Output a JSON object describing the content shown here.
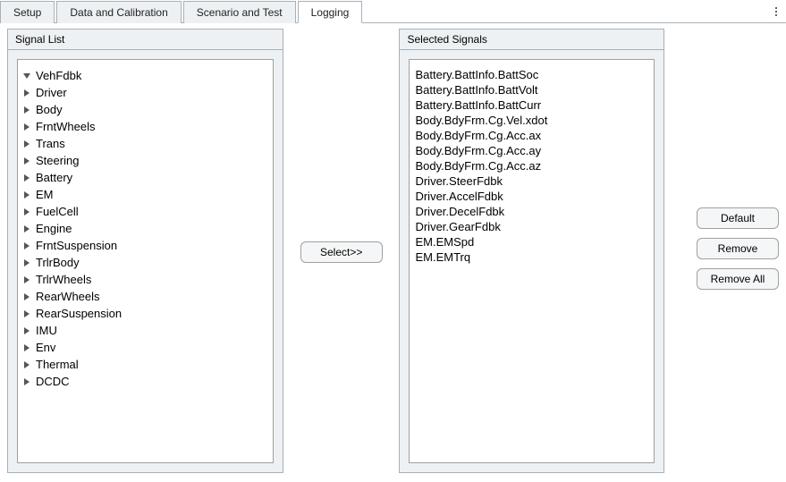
{
  "tabs": {
    "items": [
      {
        "label": "Setup",
        "active": false
      },
      {
        "label": "Data and Calibration",
        "active": false
      },
      {
        "label": "Scenario and Test",
        "active": false
      },
      {
        "label": "Logging",
        "active": true
      }
    ]
  },
  "signal_list": {
    "title": "Signal List",
    "root": {
      "label": "VehFdbk",
      "expanded": true,
      "children": [
        {
          "label": "Driver"
        },
        {
          "label": "Body"
        },
        {
          "label": "FrntWheels"
        },
        {
          "label": "Trans"
        },
        {
          "label": "Steering"
        },
        {
          "label": "Battery"
        },
        {
          "label": "EM"
        },
        {
          "label": "FuelCell"
        },
        {
          "label": "Engine"
        },
        {
          "label": "FrntSuspension"
        },
        {
          "label": "TrlrBody"
        },
        {
          "label": "TrlrWheels"
        },
        {
          "label": "RearWheels"
        },
        {
          "label": "RearSuspension"
        },
        {
          "label": "IMU"
        },
        {
          "label": "Env"
        },
        {
          "label": "Thermal"
        },
        {
          "label": "DCDC"
        }
      ]
    }
  },
  "buttons": {
    "select": "Select>>",
    "default": "Default",
    "remove": "Remove",
    "remove_all": "Remove All"
  },
  "selected_signals": {
    "title": "Selected Signals",
    "items": [
      "Battery.BattInfo.BattSoc",
      "Battery.BattInfo.BattVolt",
      "Battery.BattInfo.BattCurr",
      "Body.BdyFrm.Cg.Vel.xdot",
      "Body.BdyFrm.Cg.Acc.ax",
      "Body.BdyFrm.Cg.Acc.ay",
      "Body.BdyFrm.Cg.Acc.az",
      "Driver.SteerFdbk",
      "Driver.AccelFdbk",
      "Driver.DecelFdbk",
      "Driver.GearFdbk",
      "EM.EMSpd",
      "EM.EMTrq"
    ]
  }
}
